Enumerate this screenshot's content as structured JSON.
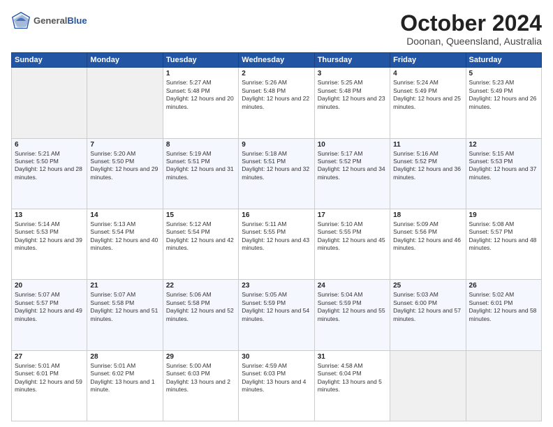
{
  "logo": {
    "general": "General",
    "blue": "Blue"
  },
  "header": {
    "month": "October 2024",
    "location": "Doonan, Queensland, Australia"
  },
  "weekdays": [
    "Sunday",
    "Monday",
    "Tuesday",
    "Wednesday",
    "Thursday",
    "Friday",
    "Saturday"
  ],
  "weeks": [
    [
      {
        "day": "",
        "empty": true
      },
      {
        "day": "",
        "empty": true
      },
      {
        "day": "1",
        "info": "Sunrise: 5:27 AM\nSunset: 5:48 PM\nDaylight: 12 hours and 20 minutes."
      },
      {
        "day": "2",
        "info": "Sunrise: 5:26 AM\nSunset: 5:48 PM\nDaylight: 12 hours and 22 minutes."
      },
      {
        "day": "3",
        "info": "Sunrise: 5:25 AM\nSunset: 5:48 PM\nDaylight: 12 hours and 23 minutes."
      },
      {
        "day": "4",
        "info": "Sunrise: 5:24 AM\nSunset: 5:49 PM\nDaylight: 12 hours and 25 minutes."
      },
      {
        "day": "5",
        "info": "Sunrise: 5:23 AM\nSunset: 5:49 PM\nDaylight: 12 hours and 26 minutes."
      }
    ],
    [
      {
        "day": "6",
        "info": "Sunrise: 5:21 AM\nSunset: 5:50 PM\nDaylight: 12 hours and 28 minutes."
      },
      {
        "day": "7",
        "info": "Sunrise: 5:20 AM\nSunset: 5:50 PM\nDaylight: 12 hours and 29 minutes."
      },
      {
        "day": "8",
        "info": "Sunrise: 5:19 AM\nSunset: 5:51 PM\nDaylight: 12 hours and 31 minutes."
      },
      {
        "day": "9",
        "info": "Sunrise: 5:18 AM\nSunset: 5:51 PM\nDaylight: 12 hours and 32 minutes."
      },
      {
        "day": "10",
        "info": "Sunrise: 5:17 AM\nSunset: 5:52 PM\nDaylight: 12 hours and 34 minutes."
      },
      {
        "day": "11",
        "info": "Sunrise: 5:16 AM\nSunset: 5:52 PM\nDaylight: 12 hours and 36 minutes."
      },
      {
        "day": "12",
        "info": "Sunrise: 5:15 AM\nSunset: 5:53 PM\nDaylight: 12 hours and 37 minutes."
      }
    ],
    [
      {
        "day": "13",
        "info": "Sunrise: 5:14 AM\nSunset: 5:53 PM\nDaylight: 12 hours and 39 minutes."
      },
      {
        "day": "14",
        "info": "Sunrise: 5:13 AM\nSunset: 5:54 PM\nDaylight: 12 hours and 40 minutes."
      },
      {
        "day": "15",
        "info": "Sunrise: 5:12 AM\nSunset: 5:54 PM\nDaylight: 12 hours and 42 minutes."
      },
      {
        "day": "16",
        "info": "Sunrise: 5:11 AM\nSunset: 5:55 PM\nDaylight: 12 hours and 43 minutes."
      },
      {
        "day": "17",
        "info": "Sunrise: 5:10 AM\nSunset: 5:55 PM\nDaylight: 12 hours and 45 minutes."
      },
      {
        "day": "18",
        "info": "Sunrise: 5:09 AM\nSunset: 5:56 PM\nDaylight: 12 hours and 46 minutes."
      },
      {
        "day": "19",
        "info": "Sunrise: 5:08 AM\nSunset: 5:57 PM\nDaylight: 12 hours and 48 minutes."
      }
    ],
    [
      {
        "day": "20",
        "info": "Sunrise: 5:07 AM\nSunset: 5:57 PM\nDaylight: 12 hours and 49 minutes."
      },
      {
        "day": "21",
        "info": "Sunrise: 5:07 AM\nSunset: 5:58 PM\nDaylight: 12 hours and 51 minutes."
      },
      {
        "day": "22",
        "info": "Sunrise: 5:06 AM\nSunset: 5:58 PM\nDaylight: 12 hours and 52 minutes."
      },
      {
        "day": "23",
        "info": "Sunrise: 5:05 AM\nSunset: 5:59 PM\nDaylight: 12 hours and 54 minutes."
      },
      {
        "day": "24",
        "info": "Sunrise: 5:04 AM\nSunset: 5:59 PM\nDaylight: 12 hours and 55 minutes."
      },
      {
        "day": "25",
        "info": "Sunrise: 5:03 AM\nSunset: 6:00 PM\nDaylight: 12 hours and 57 minutes."
      },
      {
        "day": "26",
        "info": "Sunrise: 5:02 AM\nSunset: 6:01 PM\nDaylight: 12 hours and 58 minutes."
      }
    ],
    [
      {
        "day": "27",
        "info": "Sunrise: 5:01 AM\nSunset: 6:01 PM\nDaylight: 12 hours and 59 minutes."
      },
      {
        "day": "28",
        "info": "Sunrise: 5:01 AM\nSunset: 6:02 PM\nDaylight: 13 hours and 1 minute."
      },
      {
        "day": "29",
        "info": "Sunrise: 5:00 AM\nSunset: 6:03 PM\nDaylight: 13 hours and 2 minutes."
      },
      {
        "day": "30",
        "info": "Sunrise: 4:59 AM\nSunset: 6:03 PM\nDaylight: 13 hours and 4 minutes."
      },
      {
        "day": "31",
        "info": "Sunrise: 4:58 AM\nSunset: 6:04 PM\nDaylight: 13 hours and 5 minutes."
      },
      {
        "day": "",
        "empty": true
      },
      {
        "day": "",
        "empty": true
      }
    ]
  ]
}
